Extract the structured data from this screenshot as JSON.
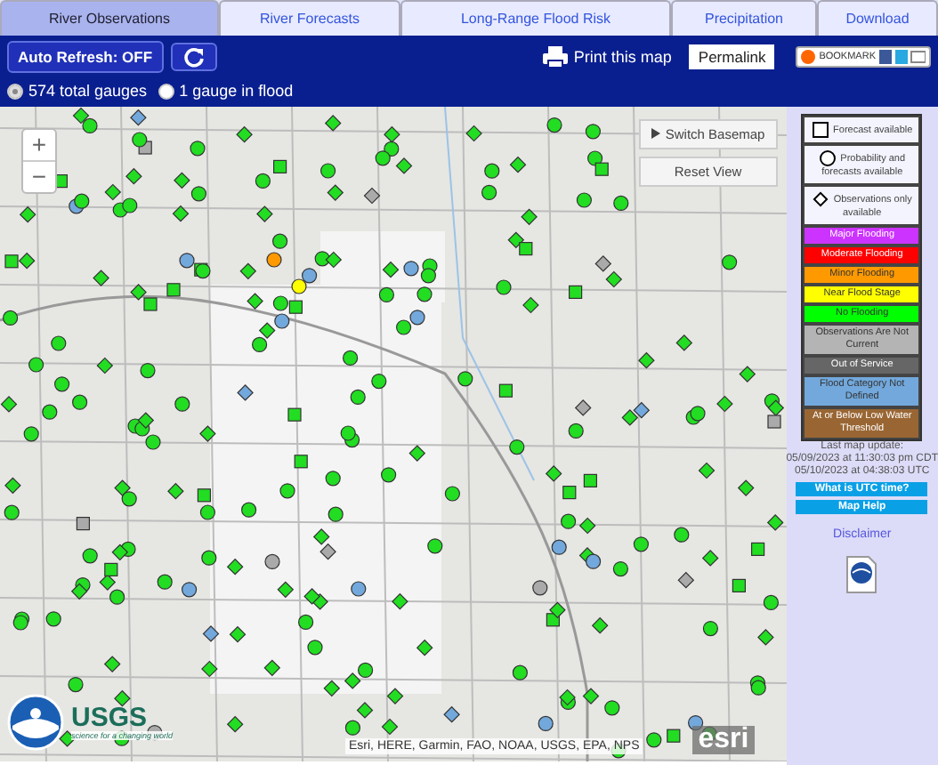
{
  "tabs": [
    {
      "label": "River Observations",
      "selected": true
    },
    {
      "label": "River Forecasts",
      "selected": false
    },
    {
      "label": "Long-Range Flood Risk",
      "selected": false
    },
    {
      "label": "Precipitation",
      "selected": false
    },
    {
      "label": "Download",
      "selected": false
    }
  ],
  "toolbar": {
    "auto_refresh": "Auto Refresh: OFF",
    "print": "Print this map",
    "permalink": "Permalink",
    "bookmark": "BOOKMARK"
  },
  "gauge_filter": [
    {
      "label": "574 total gauges",
      "selected": true
    },
    {
      "label": "1 gauge in flood",
      "selected": false
    }
  ],
  "map": {
    "zoom_buttons": [
      "+",
      "−"
    ],
    "buttons": [
      "Switch Basemap",
      "Reset View"
    ],
    "attribution": "Esri, HERE, Garmin, FAO, NOAA, USGS, EPA, NPS",
    "usgs_logo": "USGS",
    "usgs_tagline": "science for a changing world",
    "esri_logo": "esri"
  },
  "legend": [
    {
      "kind": "square",
      "label": "Forecast available"
    },
    {
      "kind": "circle",
      "label": "Probability and forecasts available"
    },
    {
      "kind": "diamond",
      "label": "Observations only available"
    },
    {
      "kind": "category",
      "label": "Major Flooding",
      "color": "#cc33ff"
    },
    {
      "kind": "category",
      "label": "Moderate Flooding",
      "color": "#ff0000"
    },
    {
      "kind": "category",
      "label": "Minor Flooding",
      "color": "#ff9900"
    },
    {
      "kind": "category",
      "label": "Near Flood Stage",
      "color": "#ffff00"
    },
    {
      "kind": "category",
      "label": "No Flooding",
      "color": "#00ff00"
    },
    {
      "kind": "category",
      "label": "Observations Are Not Current",
      "color": "#b4b4b4"
    },
    {
      "kind": "category",
      "label": "Out of Service",
      "color": "#666666"
    },
    {
      "kind": "category",
      "label": "Flood Category Not Defined",
      "color": "#72a8dc"
    },
    {
      "kind": "category",
      "label": "At or Below Low Water Threshold",
      "color": "#996633"
    }
  ],
  "update": {
    "title": "Last map update:",
    "local": "05/09/2023 at 11:30:03 pm CDT",
    "utc": "05/10/2023 at 04:38:03 UTC"
  },
  "links": [
    "What is UTC time?",
    "Map Help"
  ],
  "disclaimer": "Disclaimer"
}
